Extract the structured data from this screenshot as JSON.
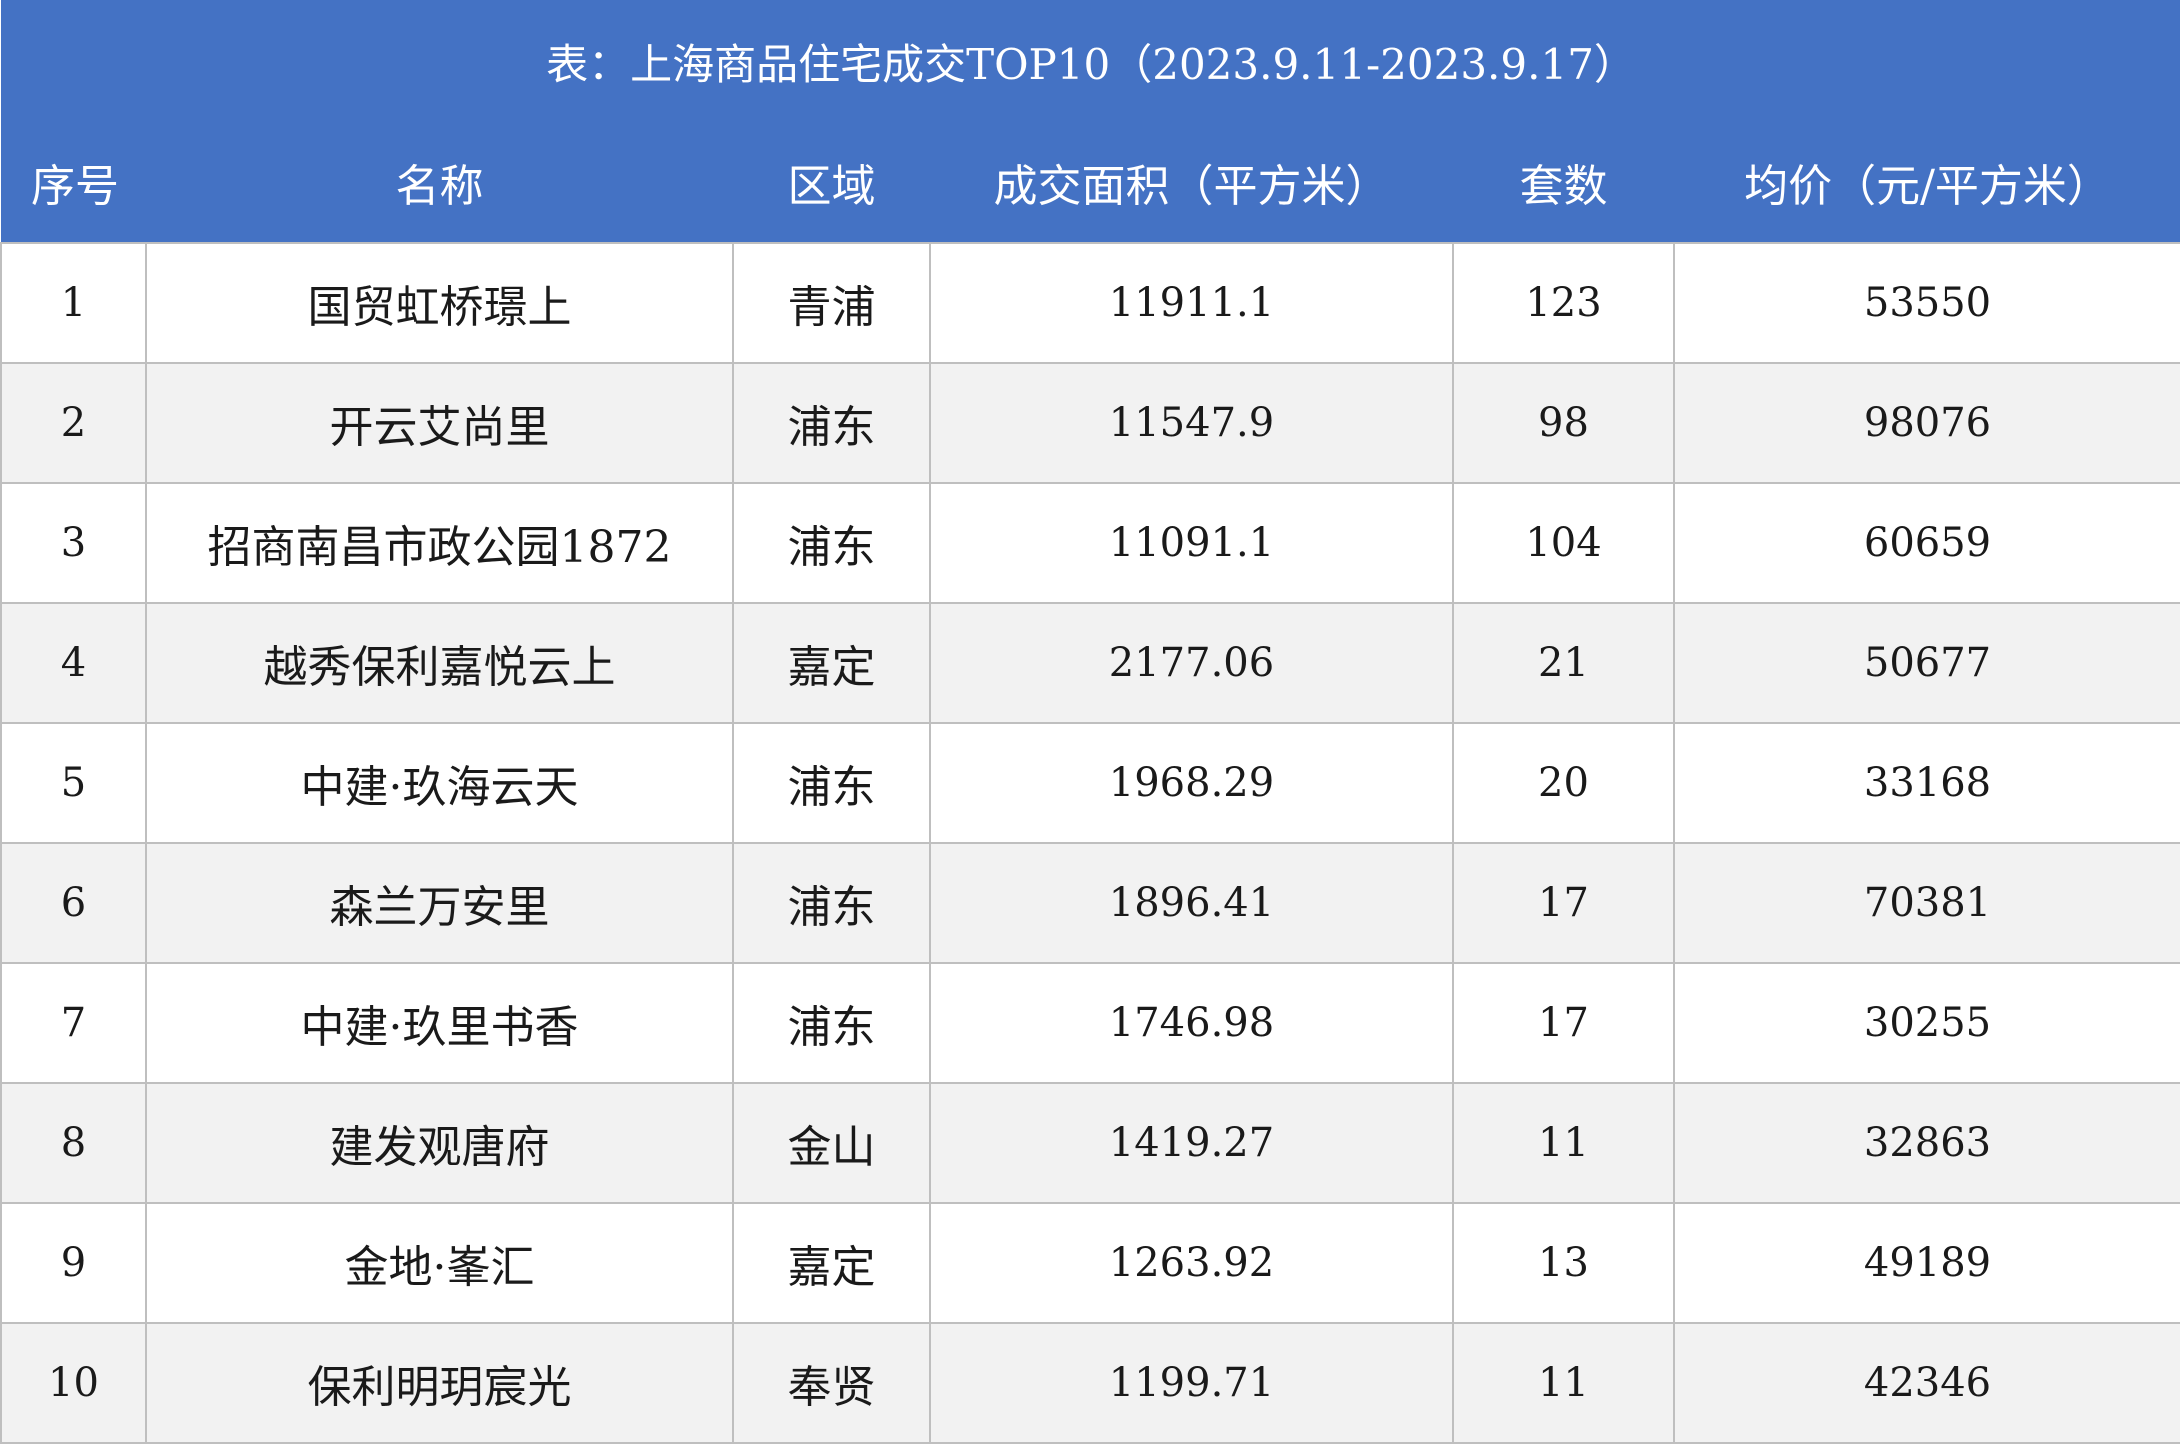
{
  "title": "表：上海商品住宅成交TOP10（2023.9.11-2023.9.17）",
  "headers": [
    "序号",
    "名称",
    "区域",
    "成交面积（平方米）",
    "套数",
    "均价（元/平方米）"
  ],
  "rows": [
    [
      "1",
      "国贸虹桥璟上",
      "青浦",
      "11911.1",
      "123",
      "53550"
    ],
    [
      "2",
      "开云艾尚里",
      "浦东",
      "11547.9",
      "98",
      "98076"
    ],
    [
      "3",
      "招商南昌市政公园1872",
      "浦东",
      "11091.1",
      "104",
      "60659"
    ],
    [
      "4",
      "越秀保利嘉悦云上",
      "嘉定",
      "2177.06",
      "21",
      "50677"
    ],
    [
      "5",
      "中建·玖海云天",
      "浦东",
      "1968.29",
      "20",
      "33168"
    ],
    [
      "6",
      "森兰万安里",
      "浦东",
      "1896.41",
      "17",
      "70381"
    ],
    [
      "7",
      "中建·玖里书香",
      "浦东",
      "1746.98",
      "17",
      "30255"
    ],
    [
      "8",
      "建发观唐府",
      "金山",
      "1419.27",
      "11",
      "32863"
    ],
    [
      "9",
      "金地·峯汇",
      "嘉定",
      "1263.92",
      "13",
      "49189"
    ],
    [
      "10",
      "保利明玥宸光",
      "奉贤",
      "1199.71",
      "11",
      "42346"
    ]
  ],
  "colors": {
    "header_bg": "#4472C4",
    "header_text": "#ffffff",
    "row_alt_bg": "#f2f2f2",
    "border": "#bfbfbf"
  }
}
